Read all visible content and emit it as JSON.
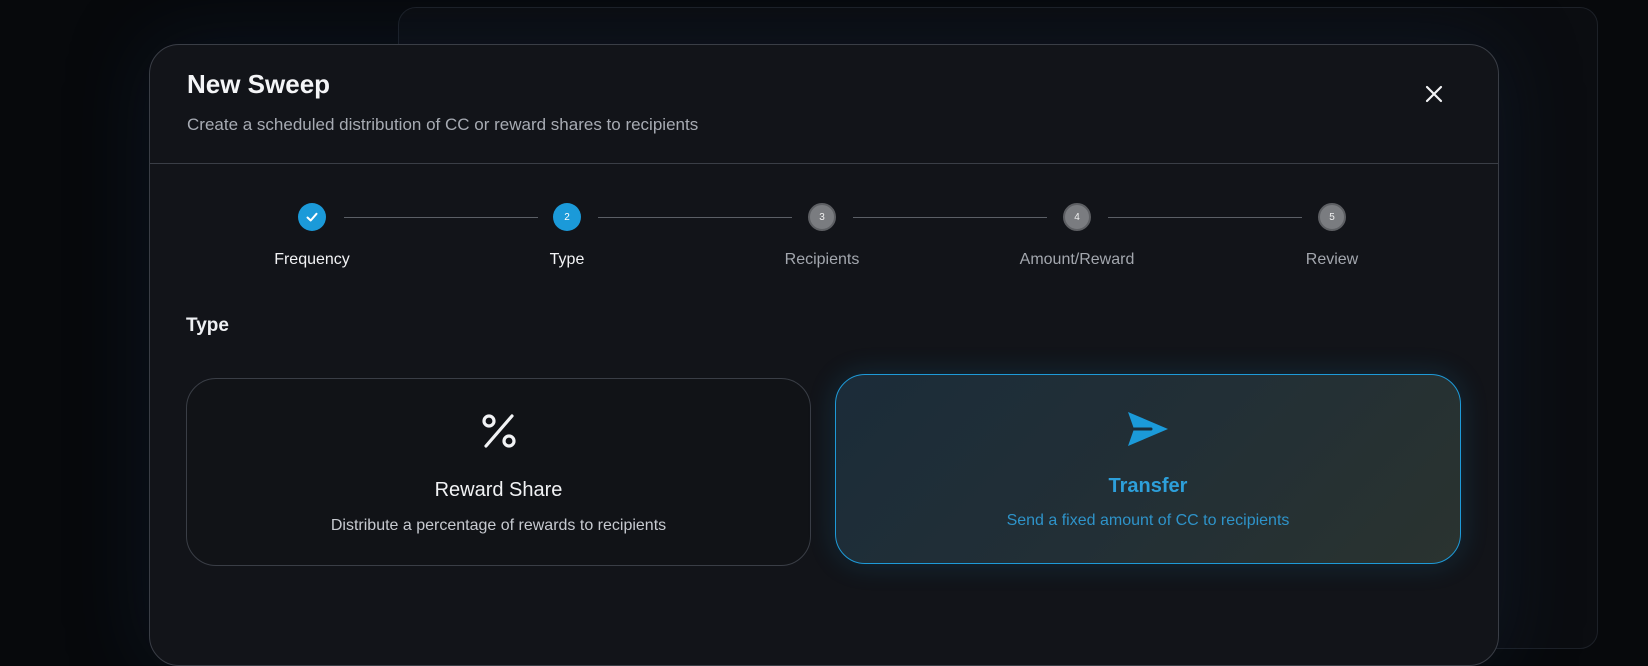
{
  "modal": {
    "title": "New Sweep",
    "subtitle": "Create a scheduled distribution of CC or reward shares to recipients",
    "close_icon": "close-icon"
  },
  "stepper": {
    "steps": [
      {
        "number": "1",
        "label": "Frequency",
        "state": "completed"
      },
      {
        "number": "2",
        "label": "Type",
        "state": "active"
      },
      {
        "number": "3",
        "label": "Recipients",
        "state": "pending"
      },
      {
        "number": "4",
        "label": "Amount/Reward",
        "state": "pending"
      },
      {
        "number": "5",
        "label": "Review",
        "state": "pending"
      }
    ]
  },
  "section": {
    "title": "Type"
  },
  "options": [
    {
      "icon": "percent-icon",
      "title": "Reward Share",
      "description": "Distribute a percentage of rewards to recipients",
      "selected": false
    },
    {
      "icon": "send-icon",
      "title": "Transfer",
      "description": "Send a fixed amount of CC to recipients",
      "selected": true
    }
  ],
  "colors": {
    "accent": "#1b9ad9",
    "background": "#121419",
    "border": "#3a3e46"
  }
}
